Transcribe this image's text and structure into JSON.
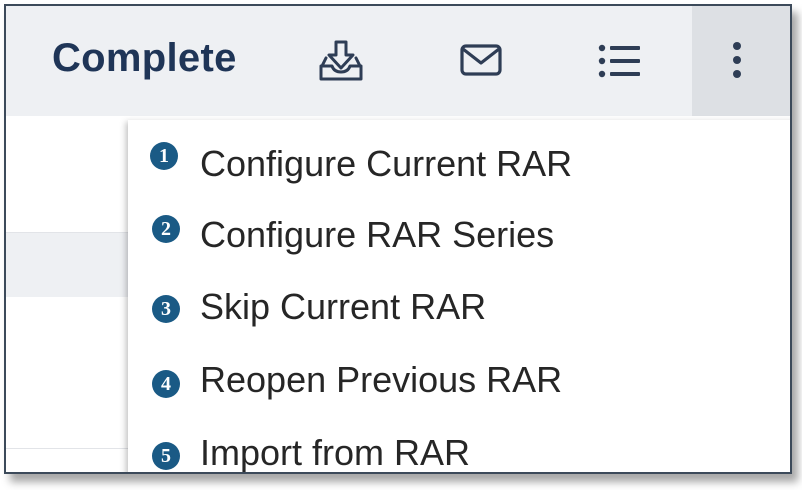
{
  "toolbar": {
    "status_label": "Complete",
    "icons": [
      "download-tray-icon",
      "envelope-icon",
      "list-icon",
      "more-vertical-icon"
    ]
  },
  "menu": {
    "items": [
      {
        "number": "1",
        "label": "Configure Current RAR"
      },
      {
        "number": "2",
        "label": "Configure RAR Series"
      },
      {
        "number": "3",
        "label": "Skip Current RAR"
      },
      {
        "number": "4",
        "label": "Reopen Previous RAR"
      },
      {
        "number": "5",
        "label": "Import from RAR"
      }
    ]
  },
  "colors": {
    "toolbar_bg": "#eef0f3",
    "title_text": "#1f3557",
    "badge": "#1a5a85",
    "menu_text": "#262626"
  }
}
